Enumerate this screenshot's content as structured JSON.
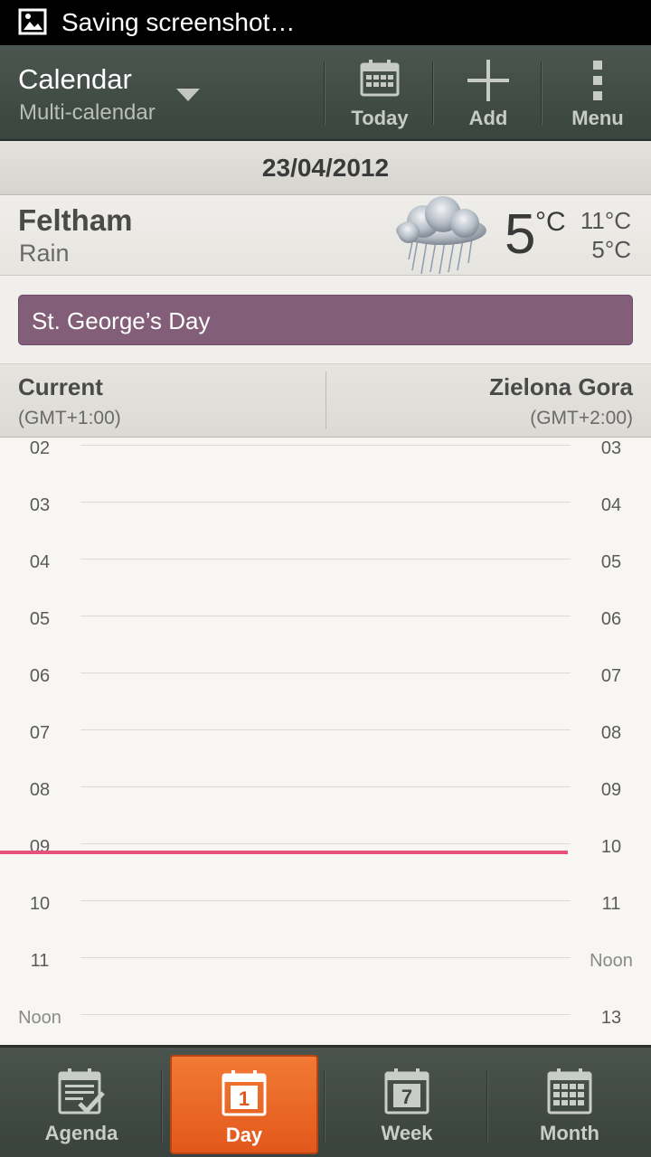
{
  "statusbar": {
    "notification": "Saving screenshot…"
  },
  "actionbar": {
    "title": "Calendar",
    "subtitle": "Multi-calendar",
    "today_label": "Today",
    "add_label": "Add",
    "menu_label": "Menu"
  },
  "date_header": "23/04/2012",
  "weather": {
    "city": "Feltham",
    "condition": "Rain",
    "temp": "5",
    "unit": "°C",
    "high": "11°C",
    "low": "5°C"
  },
  "event": {
    "title": "St. George’s Day",
    "color": "#835e78"
  },
  "timezones": {
    "left": {
      "name": "Current",
      "offset": "(GMT+1:00)"
    },
    "right": {
      "name": "Zielona Gora",
      "offset": "(GMT+2:00)"
    }
  },
  "hours_left": [
    "02",
    "03",
    "04",
    "05",
    "06",
    "07",
    "08",
    "09",
    "10",
    "11",
    "Noon"
  ],
  "hours_right": [
    "03",
    "04",
    "05",
    "06",
    "07",
    "08",
    "09",
    "10",
    "11",
    "Noon",
    "13"
  ],
  "current_time_color": "#e7517b",
  "tabs": [
    {
      "label": "Agenda",
      "icon": "agenda-icon",
      "active": false
    },
    {
      "label": "Day",
      "icon": "day-icon",
      "active": true,
      "day_number": "1"
    },
    {
      "label": "Week",
      "icon": "week-icon",
      "active": false,
      "day_number": "7"
    },
    {
      "label": "Month",
      "icon": "month-icon",
      "active": false
    }
  ],
  "accent_color": "#f27a33"
}
